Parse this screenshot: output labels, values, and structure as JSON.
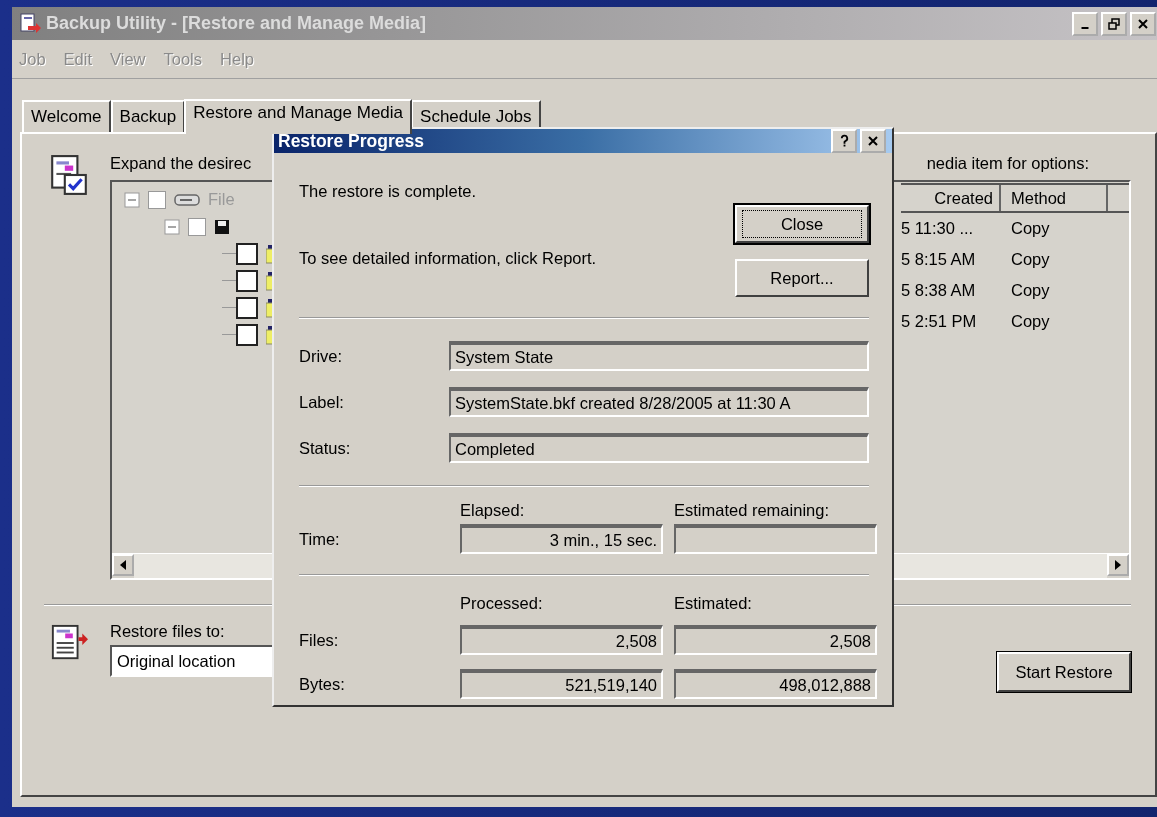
{
  "window": {
    "title": "Backup Utility - [Restore and Manage Media]"
  },
  "menu": [
    "Job",
    "Edit",
    "View",
    "Tools",
    "Help"
  ],
  "tabs": [
    {
      "label": "Welcome",
      "selected": false
    },
    {
      "label": "Backup",
      "selected": false
    },
    {
      "label": "Restore and Manage Media",
      "selected": true
    },
    {
      "label": "Schedule Jobs",
      "selected": false
    }
  ],
  "restore_page": {
    "instruction": "Expand the desirec",
    "options_hint": "nedia item for options:",
    "tree": [
      {
        "label": "File",
        "checked": false,
        "expanded": true,
        "children": [
          {
            "checked": false,
            "expanded": true,
            "children": [
              {
                "checked": false
              },
              {
                "checked": false
              },
              {
                "checked": false
              },
              {
                "checked": false
              }
            ]
          }
        ]
      }
    ],
    "list": {
      "columns": [
        "Created",
        "Method"
      ],
      "rows": [
        {
          "created": "5 11:30 ...",
          "method": "Copy"
        },
        {
          "created": "5 8:15 AM",
          "method": "Copy"
        },
        {
          "created": "5 8:38 AM",
          "method": "Copy"
        },
        {
          "created": "5 2:51 PM",
          "method": "Copy"
        }
      ]
    },
    "restore_to": {
      "label": "Restore files to:",
      "value": "Original location"
    },
    "start_button": "Start Restore"
  },
  "dialog": {
    "title": "Restore Progress",
    "message": "The restore is complete.",
    "info": "To see detailed information, click Report.",
    "buttons": [
      {
        "label": "Close",
        "default": true
      },
      {
        "label": "Report...",
        "default": false
      }
    ],
    "details": [
      {
        "label": "Drive:",
        "value": "System State"
      },
      {
        "label": "Label:",
        "value": "SystemState.bkf created 8/28/2005 at 11:30 A"
      },
      {
        "label": "Status:",
        "value": "Completed"
      }
    ],
    "time": {
      "label": "Time:",
      "headings": [
        "Elapsed:",
        "Estimated remaining:"
      ],
      "values": [
        "3 min., 15 sec."
      ]
    },
    "counts": {
      "headings": [
        "Processed:",
        "Estimated:"
      ],
      "rows": [
        {
          "label": "Files:",
          "values": [
            "2,508",
            "2,508"
          ]
        },
        {
          "label": "Bytes:",
          "values": [
            "521,519,140",
            "498,012,888"
          ]
        }
      ]
    }
  }
}
